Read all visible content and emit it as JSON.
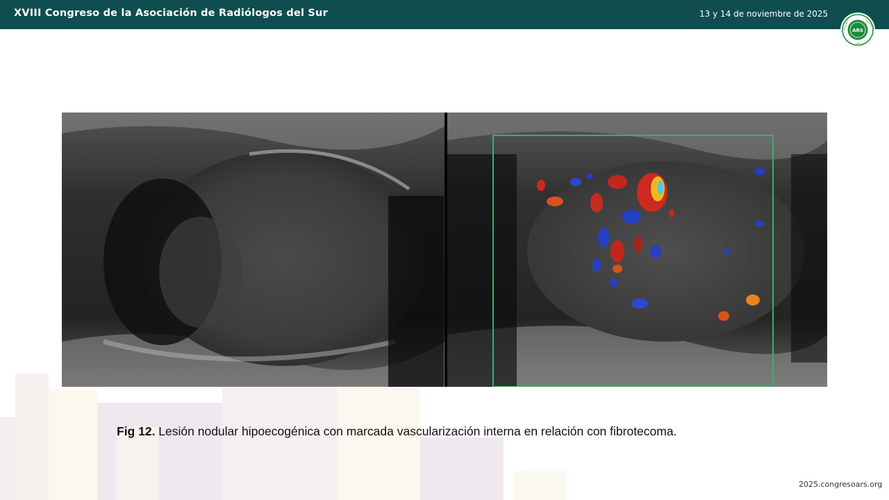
{
  "header": {
    "title": "XVIII Congreso de la Asociación de Radiólogos del Sur",
    "date": "13 y 14 de noviembre de 2025",
    "logo_text": "ARS",
    "logo_ring_text_top": "RADIÓLOGOS",
    "logo_ring_text_left": "ASOCIACIÓN",
    "logo_ring_text_bottom": "SUR"
  },
  "figure": {
    "caption_label": "Fig 12.",
    "caption_text": " Lesión nodular hipoecogénica con marcada vascularización interna en relación con fibrotecoma."
  },
  "footer": {
    "url": "2025.congresoars.org"
  },
  "colors": {
    "header_bg": "#0f4d4f",
    "logo_green": "#1e8c3a",
    "doppler_box": "#33b46a",
    "background_shapes": "#f1ecf0"
  }
}
